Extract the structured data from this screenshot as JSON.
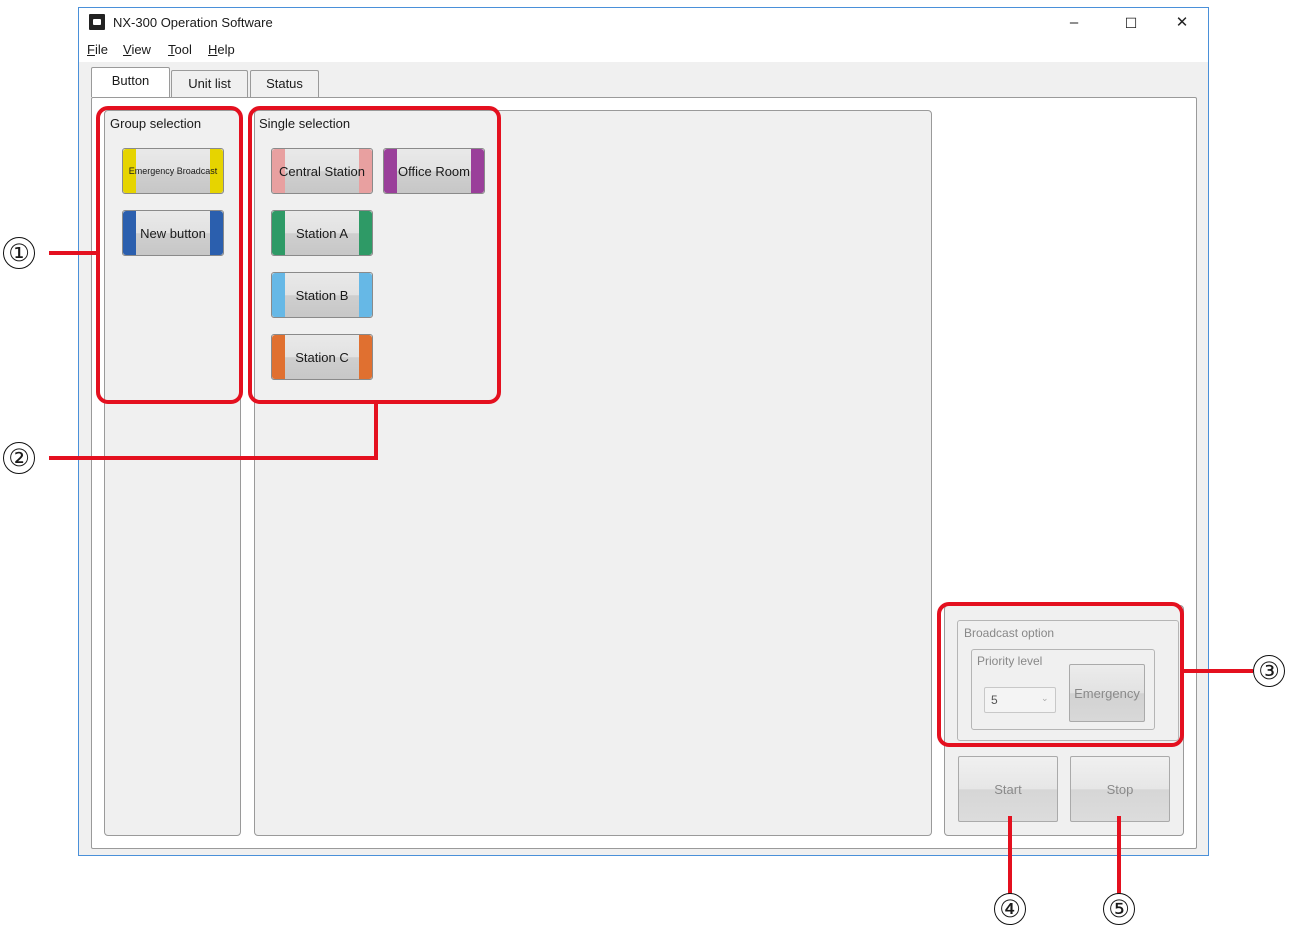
{
  "window": {
    "title": "NX-300 Operation Software",
    "controls": {
      "minimize": "–",
      "maximize": "☐",
      "close": "✕"
    }
  },
  "menu": [
    {
      "hotkey": "F",
      "rest": "ile"
    },
    {
      "hotkey": "V",
      "rest": "iew"
    },
    {
      "hotkey": "T",
      "rest": "ool"
    },
    {
      "hotkey": "H",
      "rest": "elp"
    }
  ],
  "tabs": [
    "Button",
    "Unit list",
    "Status"
  ],
  "group_selection": {
    "label": "Group selection",
    "buttons": [
      {
        "label": "Emergency Broadcast",
        "color": "#e6d400"
      },
      {
        "label": "New button",
        "color": "#2b5fae"
      }
    ]
  },
  "single_selection": {
    "label": "Single selection",
    "buttons": [
      {
        "label": "Central Station",
        "color": "#e8a0a0"
      },
      {
        "label": "Office Room",
        "color": "#9a3f9a"
      },
      {
        "label": "Station A",
        "color": "#2e9a66"
      },
      {
        "label": "Station B",
        "color": "#66b8e6"
      },
      {
        "label": "Station C",
        "color": "#e07030"
      }
    ]
  },
  "broadcast_option": {
    "label": "Broadcast option",
    "priority_label": "Priority level",
    "priority_value": "5",
    "emergency_label": "Emergency"
  },
  "actions": {
    "start": "Start",
    "stop": "Stop"
  },
  "callouts": [
    "①",
    "②",
    "③",
    "④",
    "⑤"
  ],
  "colors": {
    "annotation_red": "#e4101f",
    "window_border": "#4a90d9"
  }
}
